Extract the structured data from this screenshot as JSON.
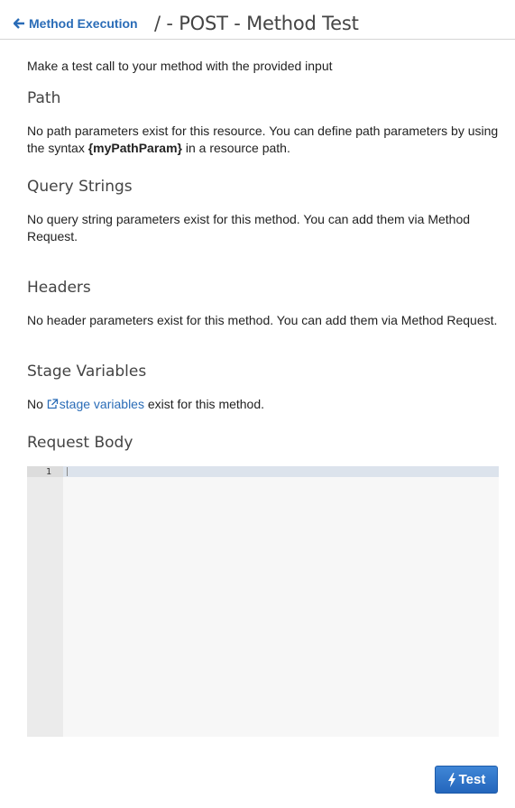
{
  "header": {
    "back_label": "Method Execution",
    "title": "/ - POST - Method Test"
  },
  "intro": "Make a test call to your method with the provided input",
  "path": {
    "title": "Path",
    "text_before": "No path parameters exist for this resource. You can define path parameters by using the syntax ",
    "code": "{myPathParam}",
    "text_after": " in a resource path."
  },
  "query_strings": {
    "title": "Query Strings",
    "text": "No query string parameters exist for this method. You can add them via Method Request."
  },
  "headers": {
    "title": "Headers",
    "text": "No header parameters exist for this method. You can add them via Method Request."
  },
  "stage_variables": {
    "title": "Stage Variables",
    "text_before": "No ",
    "link": "stage variables",
    "text_after": " exist for this method."
  },
  "request_body": {
    "title": "Request Body",
    "line_number": "1",
    "content": ""
  },
  "test_button": {
    "label": "Test"
  },
  "colors": {
    "link": "#2a6cb7",
    "button": "#2f74c8"
  },
  "icons": {
    "back": "arrow-left-icon",
    "external": "external-link-icon",
    "bolt": "bolt-icon"
  }
}
